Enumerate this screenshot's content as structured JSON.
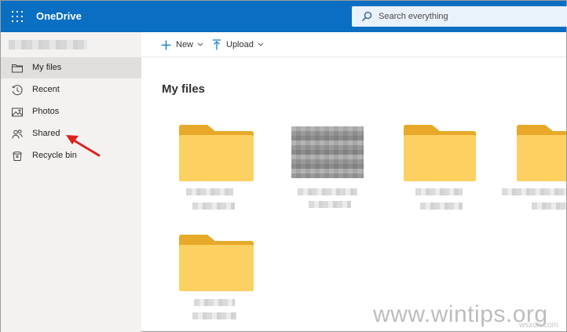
{
  "header": {
    "app_title": "OneDrive",
    "search_placeholder": "Search everything",
    "bg_color": "#0a6ec2"
  },
  "sidebar": {
    "items": [
      {
        "label": "My files",
        "icon": "folder-icon",
        "selected": true
      },
      {
        "label": "Recent",
        "icon": "clock-icon",
        "selected": false
      },
      {
        "label": "Photos",
        "icon": "image-icon",
        "selected": false
      },
      {
        "label": "Shared",
        "icon": "people-icon",
        "selected": false
      },
      {
        "label": "Recycle bin",
        "icon": "trash-icon",
        "selected": false
      }
    ]
  },
  "toolbar": {
    "new_label": "New",
    "upload_label": "Upload",
    "accent_color": "#0078d4"
  },
  "main": {
    "title": "My files",
    "items": [
      {
        "type": "folder"
      },
      {
        "type": "image"
      },
      {
        "type": "folder"
      },
      {
        "type": "folder"
      },
      {
        "type": "folder"
      }
    ]
  },
  "annotation": {
    "arrow_color": "#e02020"
  },
  "watermark": {
    "text": "www.wintips.org",
    "subtext": "wsxdn.com"
  }
}
